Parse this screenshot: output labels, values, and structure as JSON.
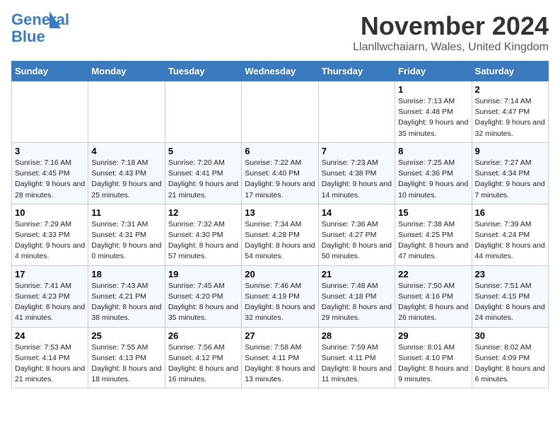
{
  "header": {
    "logo_line1": "General",
    "logo_line2": "Blue",
    "month": "November 2024",
    "location": "Llanllwchaiarn, Wales, United Kingdom"
  },
  "weekdays": [
    "Sunday",
    "Monday",
    "Tuesday",
    "Wednesday",
    "Thursday",
    "Friday",
    "Saturday"
  ],
  "weeks": [
    [
      {
        "day": "",
        "info": ""
      },
      {
        "day": "",
        "info": ""
      },
      {
        "day": "",
        "info": ""
      },
      {
        "day": "",
        "info": ""
      },
      {
        "day": "",
        "info": ""
      },
      {
        "day": "1",
        "info": "Sunrise: 7:13 AM\nSunset: 4:48 PM\nDaylight: 9 hours\nand 35 minutes."
      },
      {
        "day": "2",
        "info": "Sunrise: 7:14 AM\nSunset: 4:47 PM\nDaylight: 9 hours\nand 32 minutes."
      }
    ],
    [
      {
        "day": "3",
        "info": "Sunrise: 7:16 AM\nSunset: 4:45 PM\nDaylight: 9 hours\nand 28 minutes."
      },
      {
        "day": "4",
        "info": "Sunrise: 7:18 AM\nSunset: 4:43 PM\nDaylight: 9 hours\nand 25 minutes."
      },
      {
        "day": "5",
        "info": "Sunrise: 7:20 AM\nSunset: 4:41 PM\nDaylight: 9 hours\nand 21 minutes."
      },
      {
        "day": "6",
        "info": "Sunrise: 7:22 AM\nSunset: 4:40 PM\nDaylight: 9 hours\nand 17 minutes."
      },
      {
        "day": "7",
        "info": "Sunrise: 7:23 AM\nSunset: 4:38 PM\nDaylight: 9 hours\nand 14 minutes."
      },
      {
        "day": "8",
        "info": "Sunrise: 7:25 AM\nSunset: 4:36 PM\nDaylight: 9 hours\nand 10 minutes."
      },
      {
        "day": "9",
        "info": "Sunrise: 7:27 AM\nSunset: 4:34 PM\nDaylight: 9 hours\nand 7 minutes."
      }
    ],
    [
      {
        "day": "10",
        "info": "Sunrise: 7:29 AM\nSunset: 4:33 PM\nDaylight: 9 hours\nand 4 minutes."
      },
      {
        "day": "11",
        "info": "Sunrise: 7:31 AM\nSunset: 4:31 PM\nDaylight: 9 hours\nand 0 minutes."
      },
      {
        "day": "12",
        "info": "Sunrise: 7:32 AM\nSunset: 4:30 PM\nDaylight: 8 hours\nand 57 minutes."
      },
      {
        "day": "13",
        "info": "Sunrise: 7:34 AM\nSunset: 4:28 PM\nDaylight: 8 hours\nand 54 minutes."
      },
      {
        "day": "14",
        "info": "Sunrise: 7:36 AM\nSunset: 4:27 PM\nDaylight: 8 hours\nand 50 minutes."
      },
      {
        "day": "15",
        "info": "Sunrise: 7:38 AM\nSunset: 4:25 PM\nDaylight: 8 hours\nand 47 minutes."
      },
      {
        "day": "16",
        "info": "Sunrise: 7:39 AM\nSunset: 4:24 PM\nDaylight: 8 hours\nand 44 minutes."
      }
    ],
    [
      {
        "day": "17",
        "info": "Sunrise: 7:41 AM\nSunset: 4:23 PM\nDaylight: 8 hours\nand 41 minutes."
      },
      {
        "day": "18",
        "info": "Sunrise: 7:43 AM\nSunset: 4:21 PM\nDaylight: 8 hours\nand 38 minutes."
      },
      {
        "day": "19",
        "info": "Sunrise: 7:45 AM\nSunset: 4:20 PM\nDaylight: 8 hours\nand 35 minutes."
      },
      {
        "day": "20",
        "info": "Sunrise: 7:46 AM\nSunset: 4:19 PM\nDaylight: 8 hours\nand 32 minutes."
      },
      {
        "day": "21",
        "info": "Sunrise: 7:48 AM\nSunset: 4:18 PM\nDaylight: 8 hours\nand 29 minutes."
      },
      {
        "day": "22",
        "info": "Sunrise: 7:50 AM\nSunset: 4:16 PM\nDaylight: 8 hours\nand 26 minutes."
      },
      {
        "day": "23",
        "info": "Sunrise: 7:51 AM\nSunset: 4:15 PM\nDaylight: 8 hours\nand 24 minutes."
      }
    ],
    [
      {
        "day": "24",
        "info": "Sunrise: 7:53 AM\nSunset: 4:14 PM\nDaylight: 8 hours\nand 21 minutes."
      },
      {
        "day": "25",
        "info": "Sunrise: 7:55 AM\nSunset: 4:13 PM\nDaylight: 8 hours\nand 18 minutes."
      },
      {
        "day": "26",
        "info": "Sunrise: 7:56 AM\nSunset: 4:12 PM\nDaylight: 8 hours\nand 16 minutes."
      },
      {
        "day": "27",
        "info": "Sunrise: 7:58 AM\nSunset: 4:11 PM\nDaylight: 8 hours\nand 13 minutes."
      },
      {
        "day": "28",
        "info": "Sunrise: 7:59 AM\nSunset: 4:11 PM\nDaylight: 8 hours\nand 11 minutes."
      },
      {
        "day": "29",
        "info": "Sunrise: 8:01 AM\nSunset: 4:10 PM\nDaylight: 8 hours\nand 9 minutes."
      },
      {
        "day": "30",
        "info": "Sunrise: 8:02 AM\nSunset: 4:09 PM\nDaylight: 8 hours\nand 6 minutes."
      }
    ]
  ]
}
